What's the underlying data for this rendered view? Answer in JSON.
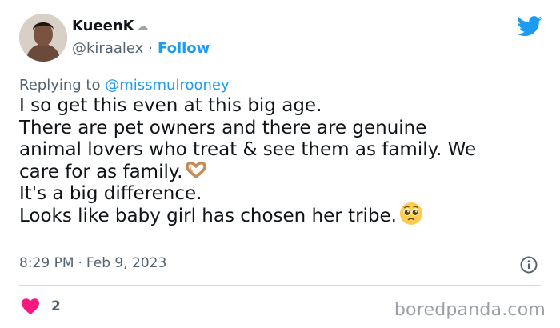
{
  "author": {
    "display_name": "KueenK",
    "name_emoji": "cloud-emoji",
    "handle": "@kiraalex",
    "separator": "·",
    "follow_label": "Follow"
  },
  "reply": {
    "prefix": "Replying to",
    "mention": "@missmulrooney"
  },
  "tweet": {
    "line1": "I so get this even at this big age.",
    "line2": "There are pet owners and there are genuine",
    "line3": "animal lovers who treat & see them as family. We",
    "line4": "care for as family.",
    "line4_emoji": "heart-hands-emoji",
    "line5": "It's a big difference.",
    "line6": "Looks like baby girl has chosen her tribe.",
    "line6_emoji": "pleading-face-emoji"
  },
  "meta": {
    "time": "8:29 PM",
    "separator": "·",
    "date": "Feb 9, 2023"
  },
  "engagement": {
    "like_count": "2",
    "like_color": "#f91880"
  },
  "brand": {
    "twitter_color": "#1d9bf0",
    "watermark": "boredpanda.com"
  }
}
